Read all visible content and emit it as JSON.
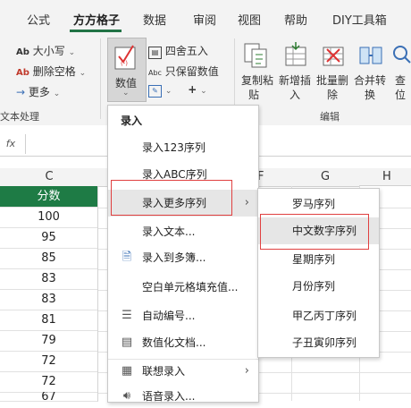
{
  "tabs": [
    "公式",
    "方方格子",
    "数据",
    "审阅",
    "视图",
    "帮助",
    "DIY工具箱"
  ],
  "ribbon": {
    "case_btn": "大小写",
    "delete_space_btn": "删除空格",
    "more_btn": "更多",
    "text_group": "文本处理",
    "value_btn": "数值",
    "round_btn": "四舍五入",
    "keep_value_btn": "只保留数值",
    "copy_paste_btn": [
      "复制粘",
      "贴"
    ],
    "insert_btn": [
      "新增插",
      "入"
    ],
    "batch_delete_btn": [
      "批量删",
      "除"
    ],
    "merge_btn": [
      "合并转",
      "换"
    ],
    "find_btn": [
      "查",
      "位"
    ],
    "edit_group": "编辑",
    "icon_ab_prefix": "Ab",
    "icon_abc_prefix": "Abc"
  },
  "formula_bar": {
    "fx": "fx"
  },
  "columns": [
    "C",
    "F",
    "G",
    "H"
  ],
  "cells": [
    "分数",
    "100",
    "95",
    "85",
    "83",
    "83",
    "81",
    "79",
    "72",
    "72",
    "67"
  ],
  "menu": {
    "title": "录入",
    "items": [
      {
        "label": "录入123序列",
        "icon": ""
      },
      {
        "label": "录入ABC序列",
        "icon": ""
      },
      {
        "label": "录入更多序列",
        "icon": "",
        "submenu": true,
        "highlighted": true
      },
      {
        "label": "录入文本...",
        "icon": ""
      },
      {
        "label": "录入到多簿...",
        "icon": "multi-book-icon"
      },
      {
        "label": "空白单元格填充值...",
        "icon": ""
      },
      {
        "label": "自动编号...",
        "icon": "numbering-icon"
      },
      {
        "label": "数值化文档...",
        "icon": "numeric-doc-icon"
      },
      {
        "label": "联想录入",
        "icon": "suggest-input-icon",
        "submenu": true
      },
      {
        "label": "语音录入...",
        "icon": "voice-icon"
      }
    ]
  },
  "submenu": {
    "items": [
      "罗马序列",
      "中文数字序列",
      "星期序列",
      "月份序列",
      "甲乙丙丁序列",
      "子丑寅卯序列"
    ],
    "highlighted": "中文数字序列"
  },
  "colors": {
    "accent": "#217346",
    "header_fill": "#1e7b45",
    "highlight_border": "#e04040"
  }
}
